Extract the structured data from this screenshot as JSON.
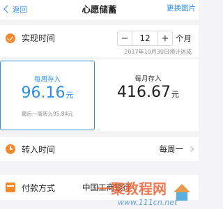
{
  "navbar": {
    "back_label": "返回",
    "title": "心愿储蓄",
    "right_label": "更换图片"
  },
  "goal": {
    "label": "实现时间",
    "stepper_minus": "−",
    "stepper_value": "12",
    "stepper_plus": "+",
    "unit": "个月",
    "eta": "2017年10月30日预计达成"
  },
  "weekly": {
    "label": "每周存入",
    "amount": "96.16",
    "currency": "元",
    "note": "最后一周转入95.84元"
  },
  "monthly": {
    "label": "每月存入",
    "amount": "416.67",
    "currency": "元"
  },
  "transfer": {
    "label": "转入时间",
    "value": "每周一"
  },
  "payment": {
    "label": "付款方式",
    "value": "中国工商银行"
  },
  "watermark": {
    "brand": "一聚教程网",
    "url": "www.111cn.net"
  },
  "colors": {
    "accent_blue": "#2e8ce6",
    "accent_orange": "#f28a2e"
  }
}
